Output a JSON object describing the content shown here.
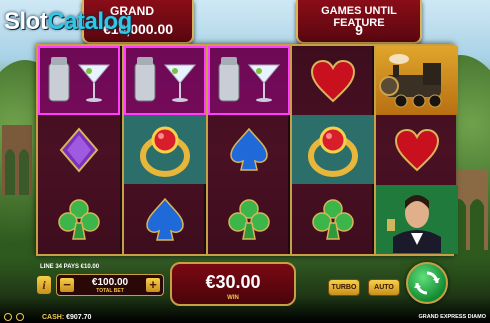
{
  "watermark": {
    "part1": "Slot",
    "part2": "Catalog"
  },
  "jackpot": {
    "title": "GRAND",
    "value": "€10,000.00"
  },
  "feature_counter": {
    "title": "GAMES UNTIL FEATURE",
    "value": "9"
  },
  "reels": [
    [
      "cocktail-shaker-and-martini",
      "purple-diamond",
      "green-club"
    ],
    [
      "cocktail-shaker-and-martini",
      "ruby-ring",
      "blue-spade"
    ],
    [
      "cocktail-shaker-and-martini",
      "blue-spade",
      "green-club"
    ],
    [
      "red-heart",
      "ruby-ring",
      "green-club"
    ],
    [
      "steam-train",
      "red-heart",
      "gentleman-with-drink"
    ]
  ],
  "info": {
    "lines_text": "LINE 34 PAYS €10.00",
    "info_label": "i"
  },
  "bet": {
    "value": "€100.00",
    "label": "TOTAL BET",
    "minus": "−",
    "plus": "+"
  },
  "win": {
    "value": "€30.00",
    "label": "WIN"
  },
  "controls": {
    "turbo": "TURBO",
    "auto": "AUTO"
  },
  "status": {
    "cash_label": "CASH:",
    "cash_value": "€907.70",
    "game_name": "GRAND EXPRESS DIAMO"
  },
  "colors": {
    "win_highlight": "#ff3cff",
    "frame_gold": "#c79f45",
    "plaque_red": "#7a0913",
    "spin_green": "#138a32"
  }
}
